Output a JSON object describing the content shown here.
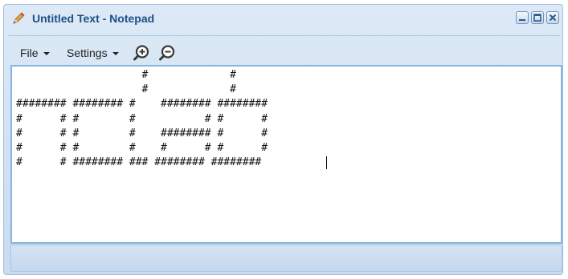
{
  "window": {
    "title": "Untitled Text - Notepad",
    "app_icon": "pencil-icon",
    "controls": [
      "minimize-icon",
      "maximize-icon",
      "close-icon"
    ]
  },
  "toolbar": {
    "file_label": "File",
    "settings_label": "Settings",
    "zoom_in_icon": "zoom-in-icon",
    "zoom_out_icon": "zoom-out-icon"
  },
  "editor": {
    "lines": [
      "                    #             #",
      "                    #             #",
      "######## ######## #    ######## ########",
      "#      # #        #           # #      #",
      "#      # #        #    ######## #      #",
      "#      # #        #    #      # #      #",
      "#      # ######## ### ######## ########"
    ]
  },
  "colors": {
    "accent": "#1c4f86",
    "window_bg": "#c9dcf0",
    "editor_border": "#86b5e2"
  }
}
